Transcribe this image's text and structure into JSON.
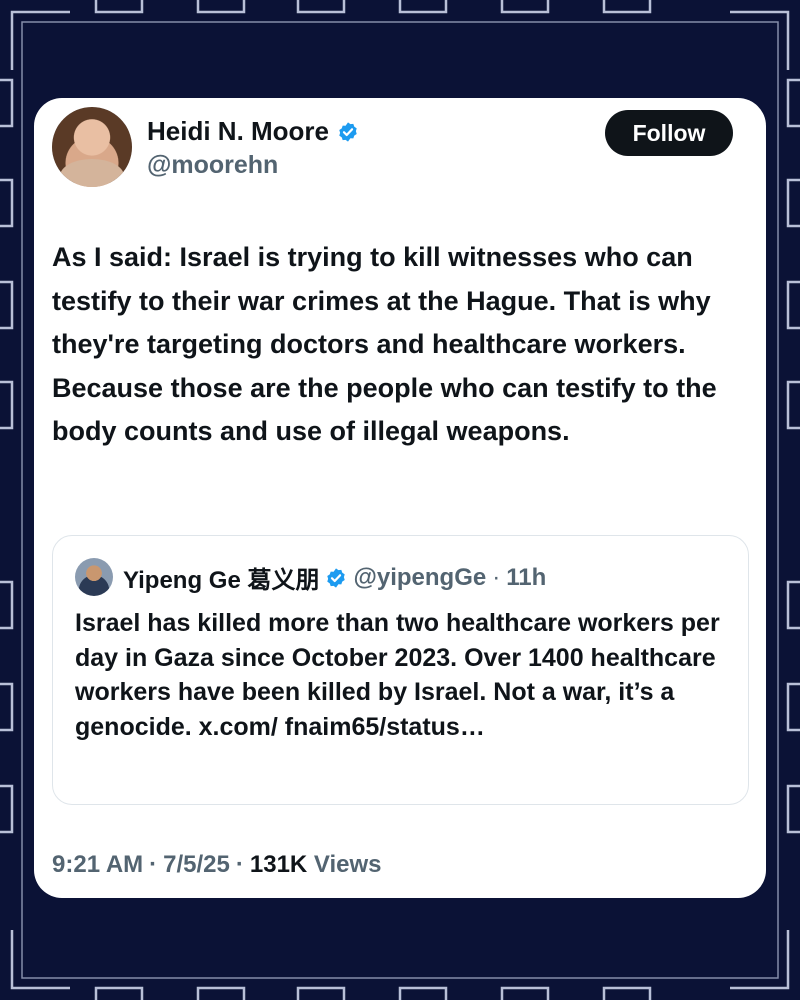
{
  "colors": {
    "background": "#0b1236",
    "frame_accent": "#b9c0d8",
    "verified_blue": "#1d9bf0",
    "follow_button_bg": "#0f1419",
    "secondary_text": "#536471"
  },
  "tweet": {
    "author": {
      "display_name": "Heidi N. Moore",
      "handle": "@moorehn",
      "verified_icon": "verified-badge-icon"
    },
    "follow_label": "Follow",
    "text": "As I said: Israel is trying to kill witnesses who can testify to their war crimes at the Hague. That is why they're targeting doctors and healthcare workers. Because those are the people who can testify to the body counts and use of illegal weapons.",
    "quote": {
      "display_name": "Yipeng Ge 葛义朋",
      "handle": "@yipengGe",
      "separator": "·",
      "time": "11h",
      "text": "Israel has killed more than two healthcare workers per day in Gaza since October 2023. Over 1400 healthcare workers have been killed by Israel. Not a war, it’s a genocide. x.com/ fnaim65/status…"
    },
    "meta": {
      "time": "9:21 AM",
      "sep1": "·",
      "date": "7/5/25",
      "sep2": "·",
      "views_count": "131K",
      "views_label": "Views"
    }
  }
}
